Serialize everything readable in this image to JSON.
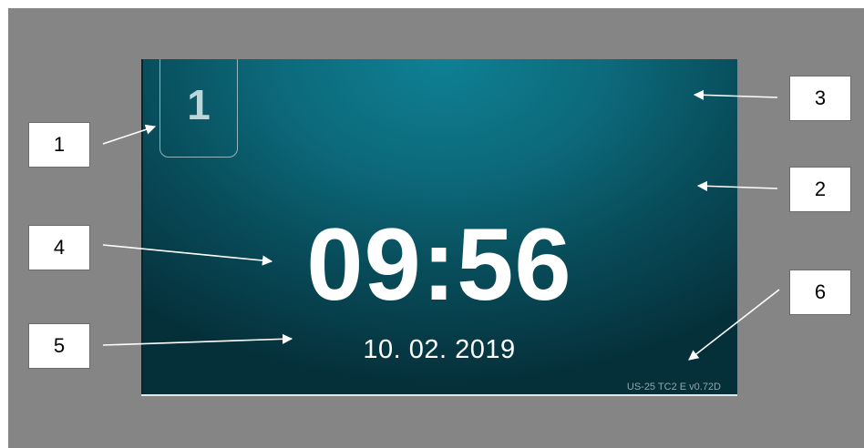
{
  "display": {
    "channel_number": "1",
    "time": "09:56",
    "date": "10. 02. 2019",
    "version": "US-25 TC2 E  v0.72D"
  },
  "callouts": [
    "1",
    "2",
    "3",
    "4",
    "5",
    "6"
  ],
  "colors": {
    "outer_background": "#858585",
    "screen_center": "#0f8094",
    "screen_edge": "#052f39",
    "text": "#ffffff",
    "version_text": "#8fa9b0"
  }
}
